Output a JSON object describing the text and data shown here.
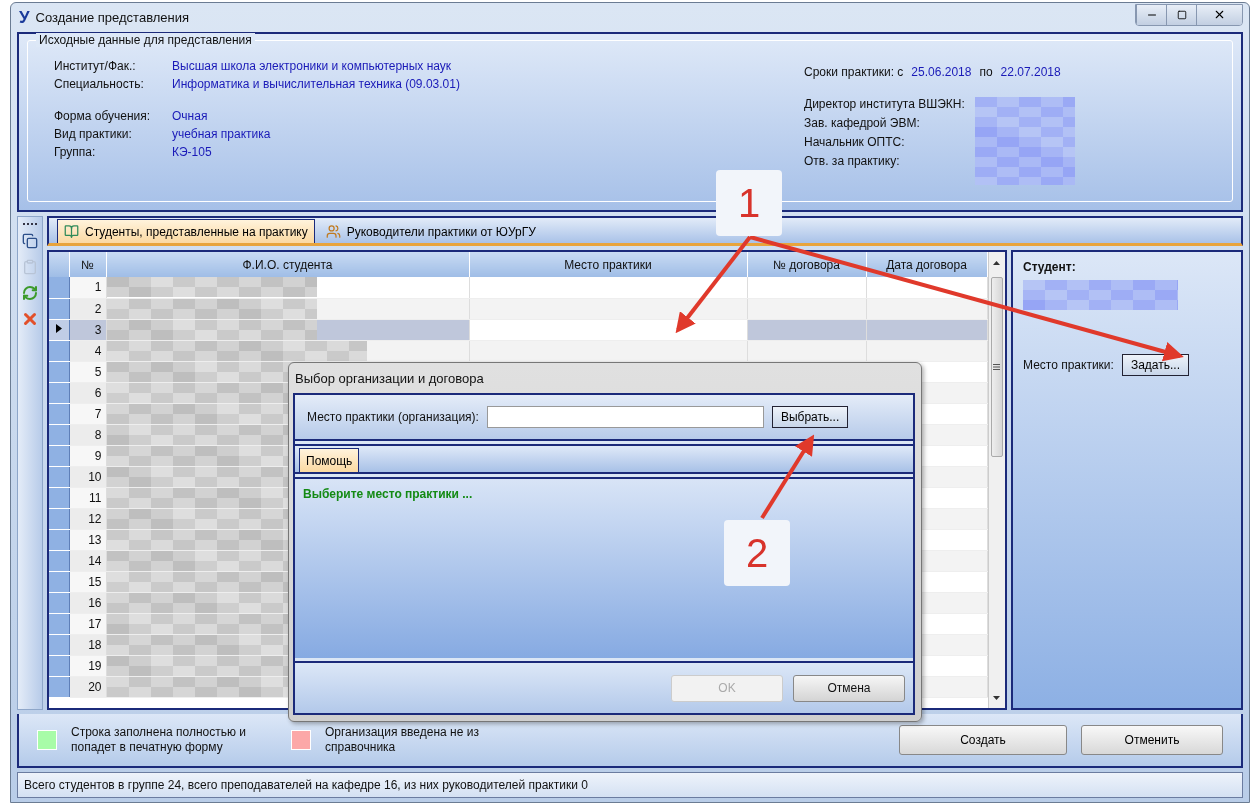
{
  "window": {
    "logo": "У",
    "title": "Создание представления"
  },
  "info": {
    "legend": "Исходные данные для представления",
    "left_groups": [
      [
        {
          "label": "Институт/Фак.:",
          "value": "Высшая школа электроники и компьютерных наук"
        },
        {
          "label": "Специальность:",
          "value": "Информатика и вычислительная техника (09.03.01)"
        }
      ],
      [
        {
          "label": "Форма обучения:",
          "value": "Очная"
        },
        {
          "label": "Вид практики:",
          "value": "учебная практика"
        },
        {
          "label": "Группа:",
          "value": "КЭ-105"
        }
      ]
    ],
    "dates": {
      "label": "Сроки практики: с",
      "from": "25.06.2018",
      "to_label": "по",
      "to": "22.07.2018"
    },
    "staff": [
      {
        "label": "Директор института ВШЭКН:"
      },
      {
        "label": "Зав. кафедрой ЭВМ:"
      },
      {
        "label": "Начальник ОПТС:"
      },
      {
        "label": "Отв. за практику:"
      }
    ]
  },
  "toolbar": [
    {
      "kind": "copy",
      "disabled": false
    },
    {
      "kind": "paste",
      "disabled": true
    },
    {
      "kind": "refresh",
      "disabled": false
    },
    {
      "kind": "delete",
      "disabled": false
    }
  ],
  "tabs": [
    {
      "label": "Студенты, представленные на практику",
      "kind": "students",
      "selected": true
    },
    {
      "label": "Руководители практики от ЮУрГУ",
      "kind": "supervisors",
      "selected": false
    }
  ],
  "table": {
    "columns": [
      "№",
      "Ф.И.О. студента",
      "Место практики",
      "№ договора",
      "Дата договора"
    ],
    "rows": [
      {
        "number": "1",
        "selected": false
      },
      {
        "number": "2",
        "selected": false
      },
      {
        "number": "3",
        "selected": true
      },
      {
        "number": "4",
        "selected": false
      },
      {
        "number": "5",
        "selected": false
      },
      {
        "number": "6",
        "selected": false
      },
      {
        "number": "7",
        "selected": false
      },
      {
        "number": "8",
        "selected": false
      },
      {
        "number": "9",
        "selected": false
      },
      {
        "number": "10",
        "selected": false
      },
      {
        "number": "11",
        "selected": false
      },
      {
        "number": "12",
        "selected": false
      },
      {
        "number": "13",
        "selected": false
      },
      {
        "number": "14",
        "selected": false
      },
      {
        "number": "15",
        "selected": false
      },
      {
        "number": "16",
        "selected": false
      },
      {
        "number": "17",
        "selected": false
      },
      {
        "number": "18",
        "selected": false
      },
      {
        "number": "19",
        "selected": false
      },
      {
        "number": "20",
        "selected": false
      }
    ]
  },
  "student_panel": {
    "title": "Студент:",
    "place_label": "Место практики:",
    "place_button": "Задать..."
  },
  "legend": [
    {
      "text": "Строка заполнена полностью и попадет в печатную форму",
      "color": "#a8fca8"
    },
    {
      "text": "Организация введена не из справочника",
      "color": "#fca8a8"
    }
  ],
  "buttons": [
    {
      "label": "Создать"
    },
    {
      "label": "Отменить"
    }
  ],
  "status_bar": "Всего студентов в группе 24, всего преподавателей на кафедре 16, из них руководителей практики 0",
  "dialog": {
    "title": "Выбор организации и договора",
    "field_label": "Место практики (организация):",
    "choose_button": "Выбрать...",
    "tabs": [
      {
        "label": "Помощь",
        "selected": true
      }
    ],
    "help": "Выберите место практики ...",
    "ok": {
      "label": "OK",
      "disabled": true
    },
    "cancel": {
      "label": "Отмена",
      "disabled": false
    }
  },
  "annotations": [
    {
      "label": "1"
    },
    {
      "label": "2"
    }
  ]
}
